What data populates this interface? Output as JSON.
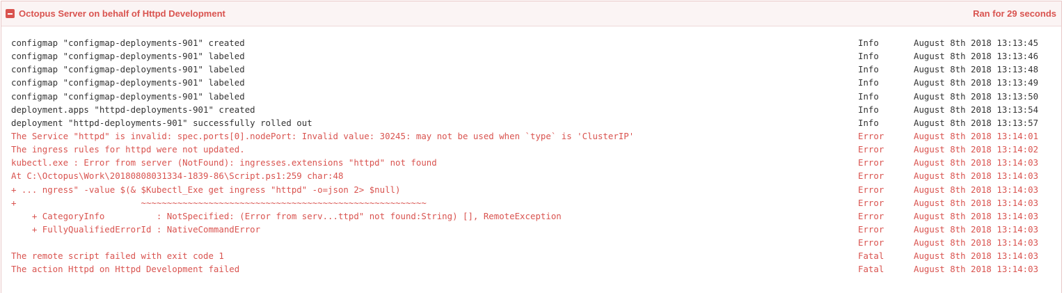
{
  "task": {
    "title": "Octopus Server on behalf of Httpd Development",
    "duration": "Ran for 29 seconds",
    "collapse_icon": "minus-square-icon",
    "accent_color": "#d9534f"
  },
  "log": [
    {
      "message": "configmap \"configmap-deployments-901\" created",
      "category": "Info",
      "time": "August 8th 2018 13:13:45"
    },
    {
      "message": "configmap \"configmap-deployments-901\" labeled",
      "category": "Info",
      "time": "August 8th 2018 13:13:46"
    },
    {
      "message": "configmap \"configmap-deployments-901\" labeled",
      "category": "Info",
      "time": "August 8th 2018 13:13:48"
    },
    {
      "message": "configmap \"configmap-deployments-901\" labeled",
      "category": "Info",
      "time": "August 8th 2018 13:13:49"
    },
    {
      "message": "configmap \"configmap-deployments-901\" labeled",
      "category": "Info",
      "time": "August 8th 2018 13:13:50"
    },
    {
      "message": "deployment.apps \"httpd-deployments-901\" created",
      "category": "Info",
      "time": "August 8th 2018 13:13:54"
    },
    {
      "message": "deployment \"httpd-deployments-901\" successfully rolled out",
      "category": "Info",
      "time": "August 8th 2018 13:13:57"
    },
    {
      "message": "The Service \"httpd\" is invalid: spec.ports[0].nodePort: Invalid value: 30245: may not be used when `type` is 'ClusterIP'",
      "category": "Error",
      "time": "August 8th 2018 13:14:01"
    },
    {
      "message": "The ingress rules for httpd were not updated.",
      "category": "Error",
      "time": "August 8th 2018 13:14:02"
    },
    {
      "message": "kubectl.exe : Error from server (NotFound): ingresses.extensions \"httpd\" not found",
      "category": "Error",
      "time": "August 8th 2018 13:14:03"
    },
    {
      "message": "At C:\\Octopus\\Work\\20180808031334-1839-86\\Script.ps1:259 char:48",
      "category": "Error",
      "time": "August 8th 2018 13:14:03"
    },
    {
      "message": "+ ... ngress\" -value $(& $Kubectl_Exe get ingress \"httpd\" -o=json 2> $null)",
      "category": "Error",
      "time": "August 8th 2018 13:14:03"
    },
    {
      "message": "+                        ~~~~~~~~~~~~~~~~~~~~~~~~~~~~~~~~~~~~~~~~~~~~~~~~~~~~~~~",
      "category": "Error",
      "time": "August 8th 2018 13:14:03"
    },
    {
      "message": "    + CategoryInfo          : NotSpecified: (Error from serv...ttpd\" not found:String) [], RemoteException",
      "category": "Error",
      "time": "August 8th 2018 13:14:03"
    },
    {
      "message": "    + FullyQualifiedErrorId : NativeCommandError",
      "category": "Error",
      "time": "August 8th 2018 13:14:03"
    },
    {
      "message": "",
      "category": "Error",
      "time": "August 8th 2018 13:14:03"
    },
    {
      "message": "The remote script failed with exit code 1",
      "category": "Fatal",
      "time": "August 8th 2018 13:14:03"
    },
    {
      "message": "The action Httpd on Httpd Development failed",
      "category": "Fatal",
      "time": "August 8th 2018 13:14:03"
    }
  ]
}
